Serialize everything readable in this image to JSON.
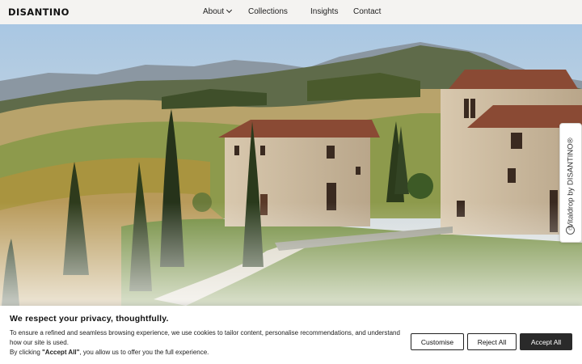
{
  "header": {
    "logo": "DISANTINO",
    "nav": {
      "about": "About",
      "collections": "Collections",
      "insights": "Insights",
      "contact": "Contact"
    }
  },
  "side_tab": {
    "label": "Vitaldrop by DISANTINO",
    "trademark": "®",
    "icon": "copyright-circle-icon"
  },
  "cookie_banner": {
    "title": "We respect your privacy, thoughtfully.",
    "line1": "To ensure a refined and seamless browsing experience, we use cookies to tailor content, personalise recommendations, and understand how our site is used.",
    "line2_prefix": "By clicking ",
    "line2_bold": "\"Accept All\"",
    "line2_suffix": ", you allow us to offer you the full experience.",
    "buttons": {
      "customise": "Customise",
      "reject": "Reject All",
      "accept": "Accept All"
    }
  },
  "colors": {
    "accept_bg": "#2a2a2a",
    "header_bg": "#f4f3f1"
  }
}
